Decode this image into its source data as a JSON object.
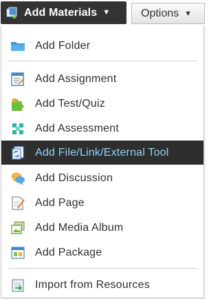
{
  "toolbar": {
    "add_materials_label": "Add Materials",
    "options_label": "Options",
    "caret_glyph": "▼"
  },
  "menu": {
    "items": [
      {
        "label": "Add Folder",
        "icon": "folder-icon"
      },
      {
        "label": "Add Assignment",
        "icon": "assignment-icon"
      },
      {
        "label": "Add Test/Quiz",
        "icon": "puzzle-icon"
      },
      {
        "label": "Add Assessment",
        "icon": "assessment-icon"
      },
      {
        "label": "Add File/Link/External Tool",
        "icon": "file-link-icon",
        "active": true
      },
      {
        "label": "Add Discussion",
        "icon": "discussion-icon"
      },
      {
        "label": "Add Page",
        "icon": "page-icon"
      },
      {
        "label": "Add Media Album",
        "icon": "media-album-icon"
      },
      {
        "label": "Add Package",
        "icon": "package-icon"
      },
      {
        "label": "Import from Resources",
        "icon": "import-icon"
      }
    ]
  },
  "colors": {
    "toolbar_button_bg": "#333333",
    "active_item_bg": "#2e2e2e",
    "active_item_text": "#8fd4ff",
    "item_text": "#2f2f2f"
  }
}
